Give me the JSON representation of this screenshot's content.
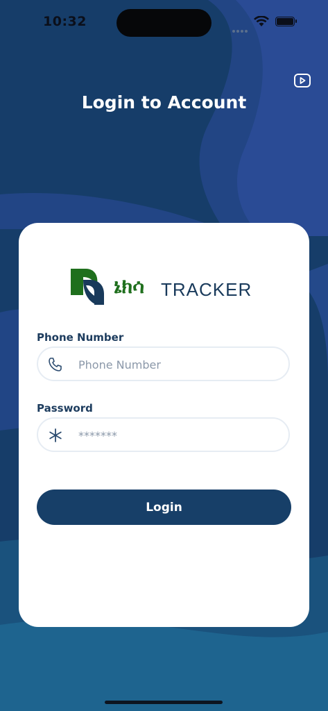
{
  "status_bar": {
    "time": "10:32"
  },
  "header": {
    "title": "Login to Account"
  },
  "logo": {
    "amharic": "ኔክሳ",
    "tracker": "TRACKER"
  },
  "form": {
    "phone": {
      "label": "Phone Number",
      "placeholder": "Phone Number",
      "value": ""
    },
    "password": {
      "label": "Password",
      "placeholder": "*******",
      "value": ""
    },
    "submit_label": "Login"
  },
  "icons": {
    "video": "video-icon",
    "phone": "phone-icon",
    "password": "asterisk-icon"
  },
  "colors": {
    "background": "#173e6a",
    "primary": "#173f68",
    "logo_green": "#1f6f1d",
    "logo_navy": "#193a5b"
  }
}
